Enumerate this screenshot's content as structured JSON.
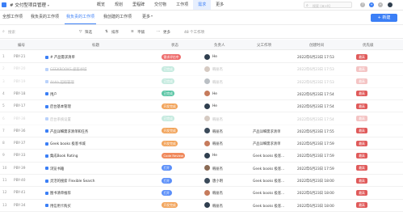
{
  "topnav": {
    "project": "# 交付型项目管理",
    "tabs": [
      "概览",
      "规划",
      "里程碑",
      "交付物",
      "工作项",
      "需求",
      "更多"
    ],
    "active_tab": 5,
    "search_placeholder": "搜索 (⌘+K)"
  },
  "views": {
    "tabs": [
      "全部工作项",
      "我负责的工作项",
      "我负责的工作项",
      "我创建的工作项",
      "更多"
    ],
    "active": 2,
    "new_button": "+ 新建"
  },
  "toolbar": {
    "search_placeholder": "搜索",
    "filter": "筛选",
    "sort": "排序",
    "tile": "平铺",
    "more": "更多",
    "count": "48 个工作项"
  },
  "table": {
    "headers": [
      "编号",
      "标题",
      "状态",
      "负责人",
      "父工作项",
      "创建时间",
      "优先级"
    ],
    "rows": [
      {
        "num": "1",
        "id": "PBY-21",
        "title": "# 产品需求清单",
        "status": "需求评估中",
        "status_color": "#ee6c6c",
        "owner": "He",
        "parent": "",
        "created": "2022年6月23日 17:53",
        "priority": "最高",
        "faded": false,
        "strike": false
      },
      {
        "num": "2",
        "id": "PBY-20",
        "title": "GEEKBOOKS 极客书城",
        "status": "已完成",
        "status_color": "#5cc6a6",
        "owner": "韩丽杰",
        "parent": "",
        "created": "2022年6月23日 17:53",
        "priority": "最高",
        "faded": true,
        "strike": true
      },
      {
        "num": "3",
        "id": "PBY-19",
        "title": "Ahhh 超级管理",
        "status": "已完成",
        "status_color": "#5cc6a6",
        "owner": "韩丽杰",
        "parent": "",
        "created": "2022年6月23日 17:53",
        "priority": "最高",
        "faded": true,
        "strike": true
      },
      {
        "num": "4",
        "id": "PBY-18",
        "title": "用户",
        "status": "已完成",
        "status_color": "#5cc6a6",
        "owner": "He",
        "parent": "",
        "created": "2022年6月23日 17:54",
        "priority": "最高",
        "faded": false,
        "strike": false
      },
      {
        "num": "5",
        "id": "PBY-17",
        "title": "后台基本管理",
        "status": "开发完成",
        "status_color": "#f2a45b",
        "owner": "He",
        "parent": "",
        "created": "2022年6月23日 17:54",
        "priority": "最高",
        "faded": false,
        "strike": false
      },
      {
        "num": "6",
        "id": "PBY-38",
        "title": "后台系统设置",
        "status": "已完成",
        "status_color": "#5cc6a6",
        "owner": "韩丽杰",
        "parent": "",
        "created": "2022年6月23日 17:54",
        "priority": "最高",
        "faded": true,
        "strike": false
      },
      {
        "num": "7",
        "id": "PBY-36",
        "title": "产品详细需求清单和任务",
        "status": "开发完成",
        "status_color": "#f2a45b",
        "owner": "韩丽杰",
        "parent": "产品详细需求清单",
        "created": "2022年6月23日 17:55",
        "priority": "最高",
        "faded": false,
        "strike": false
      },
      {
        "num": "8",
        "id": "PBY-37",
        "title": "Geek books 极客书城",
        "status": "开发完成",
        "status_color": "#f2a45b",
        "owner": "韩丽杰",
        "parent": "产品详细需求清单",
        "created": "2022年6月23日 17:59",
        "priority": "最高",
        "faded": false,
        "strike": false
      },
      {
        "num": "9",
        "id": "PBY-33",
        "title": "集成Book Rating",
        "status": "Code Review",
        "status_color": "#f08a5d",
        "owner": "He",
        "parent": "Geek books 极客...",
        "created": "2022年6月23日 17:59",
        "priority": "最高",
        "faded": false,
        "strike": false
      },
      {
        "num": "10",
        "id": "PBY-39",
        "title": "浏览书籍",
        "status": "打开",
        "status_color": "#5b8ff9",
        "owner": "韩丽杰",
        "parent": "Geek books 极客...",
        "created": "2022年6月23日 17:59",
        "priority": "最高",
        "faded": false,
        "strike": false
      },
      {
        "num": "11",
        "id": "PBY-40",
        "title": "灵活的搜索 Flexible Search",
        "status": "打开",
        "status_color": "#5b8ff9",
        "owner": "唐小明",
        "parent": "Geek books 极客...",
        "created": "2022年6月23日 18:00",
        "priority": "最高",
        "faded": false,
        "strike": false
      },
      {
        "num": "12",
        "id": "PBY-41",
        "title": "图书清单推荐",
        "status": "打开",
        "status_color": "#5b8ff9",
        "owner": "韩丽杰",
        "parent": "Geek books 极客...",
        "created": "2022年6月23日 18:00",
        "priority": "最高",
        "faded": false,
        "strike": false
      },
      {
        "num": "13",
        "id": "PBY-34",
        "title": "用信用卡购买",
        "status": "开发完成",
        "status_color": "#f2a45b",
        "owner": "韩丽杰",
        "parent": "Geek books 极客...",
        "created": "2022年6月23日 18:00",
        "priority": "最高",
        "faded": false,
        "strike": false
      }
    ]
  },
  "colors": {
    "accent": "#3b7ff6",
    "priority_high": "#e05a5a",
    "avatar_colors": [
      "#2f3e4e",
      "#8a6a54",
      "#3b4a5a",
      "#c67b5c"
    ]
  }
}
